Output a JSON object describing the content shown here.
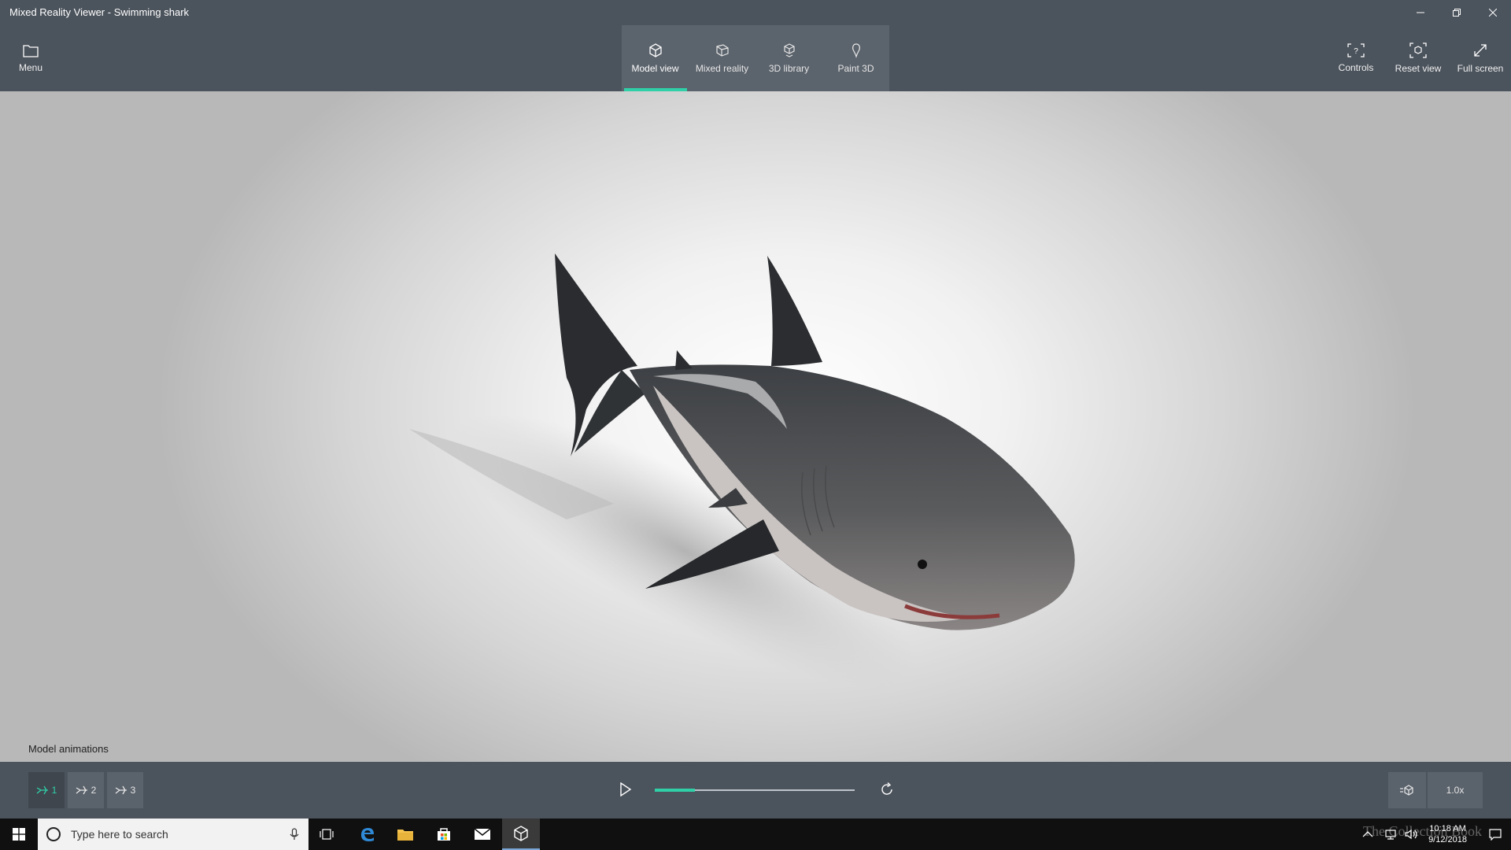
{
  "window": {
    "title": "Mixed Reality Viewer - Swimming shark"
  },
  "toolbar": {
    "menu_label": "Menu",
    "tabs": [
      {
        "label": "Model view",
        "icon": "cube-icon",
        "active": true
      },
      {
        "label": "Mixed reality",
        "icon": "mixed-reality-icon",
        "active": false
      },
      {
        "label": "3D library",
        "icon": "library-icon",
        "active": false
      },
      {
        "label": "Paint 3D",
        "icon": "paint3d-icon",
        "active": false
      }
    ],
    "right": [
      {
        "label": "Controls",
        "icon": "controls-icon"
      },
      {
        "label": "Reset view",
        "icon": "reset-view-icon"
      },
      {
        "label": "Full screen",
        "icon": "fullscreen-icon"
      }
    ]
  },
  "animations": {
    "label": "Model animations",
    "items": [
      {
        "number": "1",
        "active": true
      },
      {
        "number": "2",
        "active": false
      },
      {
        "number": "3",
        "active": false
      }
    ],
    "progress": 0.2,
    "speed": "1.0x"
  },
  "taskbar": {
    "search_placeholder": "Type here to search",
    "time": "10:18 AM",
    "date": "9/12/2018"
  },
  "watermark": "The Collection Book",
  "colors": {
    "accent": "#2fd0a8",
    "chrome": "#4b535c"
  }
}
